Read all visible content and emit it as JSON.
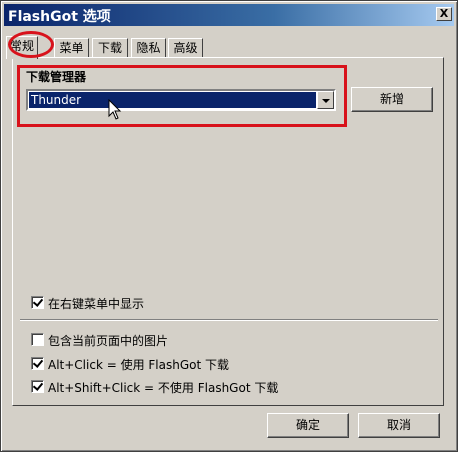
{
  "window": {
    "title": "FlashGot 选项",
    "close_label": "X"
  },
  "tabs": [
    {
      "label": "常规",
      "active": true
    },
    {
      "label": "菜单",
      "active": false
    },
    {
      "label": "下载",
      "active": false
    },
    {
      "label": "隐私",
      "active": false
    },
    {
      "label": "高级",
      "active": false
    }
  ],
  "download_manager": {
    "section_label": "下载管理器",
    "selected_value": "Thunder",
    "add_button_label": "新增"
  },
  "options": {
    "show_in_context_menu": {
      "label": "在右键菜单中显示",
      "checked": true
    },
    "include_page_images": {
      "label": "包含当前页面中的图片",
      "checked": false
    },
    "alt_click": {
      "label": "Alt+Click = 使用 FlashGot 下载",
      "checked": true
    },
    "alt_shift_click": {
      "label": "Alt+Shift+Click = 不使用 FlashGot 下载",
      "checked": true
    }
  },
  "footer": {
    "ok_label": "确定",
    "cancel_label": "取消"
  },
  "colors": {
    "highlight": "#d8121b",
    "title_bar": "#0a246a",
    "selection": "#0a246a",
    "dialog_face": "#d4d0c8"
  },
  "icons": {
    "cursor": "arrow-cursor-icon",
    "dropdown": "chevron-down-icon",
    "checkmark": "checkmark-icon"
  }
}
